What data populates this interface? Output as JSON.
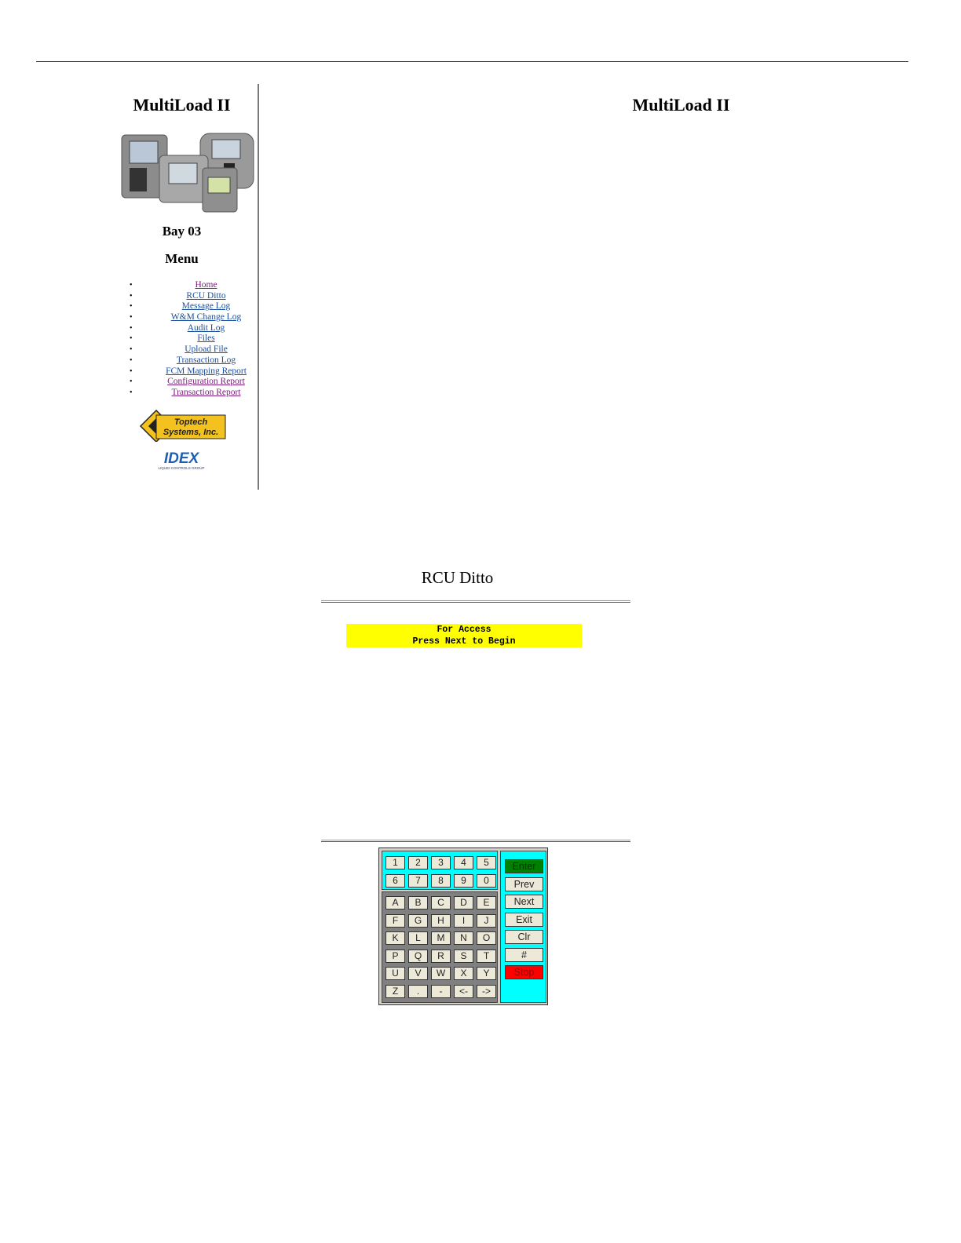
{
  "sidebar": {
    "title": "MultiLoad II",
    "bay": "Bay 03",
    "menu_heading": "Menu",
    "menu_items": [
      {
        "label": "Home",
        "visited": true
      },
      {
        "label": "RCU Ditto",
        "visited": false
      },
      {
        "label": "Message Log",
        "visited": false
      },
      {
        "label": "W&M Change Log",
        "visited": false
      },
      {
        "label": "Audit Log",
        "visited": false
      },
      {
        "label": "Files",
        "visited": false
      },
      {
        "label": "Upload File",
        "visited": false
      },
      {
        "label": "Transaction Log",
        "visited": false
      },
      {
        "label": "FCM Mapping Report",
        "visited": false
      },
      {
        "label": "Configuration Report",
        "visited": true
      },
      {
        "label": "Transaction Report",
        "visited": true
      }
    ],
    "logo_text_1": "Toptech",
    "logo_text_2": "Systems, Inc.",
    "idex_text": "IDEX",
    "idex_sub": "LIQUID CONTROLS GROUP"
  },
  "main": {
    "title": "MultiLoad II"
  },
  "rcu": {
    "title": "RCU Ditto",
    "display_lines": [
      "For Access",
      "Press Next to Begin"
    ],
    "display_color": "#ffff00"
  },
  "keypad": {
    "numeric_rows": [
      [
        "1",
        "2",
        "3",
        "4",
        "5"
      ],
      [
        "6",
        "7",
        "8",
        "9",
        "0"
      ]
    ],
    "alpha_rows": [
      [
        "A",
        "B",
        "C",
        "D",
        "E"
      ],
      [
        "F",
        "G",
        "H",
        "I",
        "J"
      ],
      [
        "K",
        "L",
        "M",
        "N",
        "O"
      ],
      [
        "P",
        "Q",
        "R",
        "S",
        "T"
      ],
      [
        "U",
        "V",
        "W",
        "X",
        "Y"
      ],
      [
        "Z",
        ".",
        "-",
        "<-",
        "->"
      ]
    ],
    "function_keys": [
      "Enter",
      "Prev",
      "Next",
      "Exit",
      "Clr",
      "#",
      "Stop"
    ],
    "enter_color": "#008000",
    "stop_color": "#ff0000",
    "panel_color": "#00ffff"
  }
}
